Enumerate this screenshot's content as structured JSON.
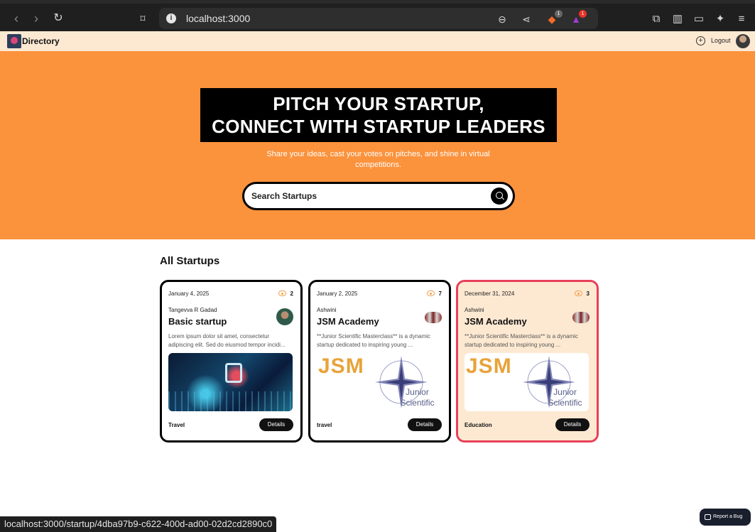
{
  "browser": {
    "url": "localhost:3000",
    "shields_count": "1",
    "rewards_count": "1"
  },
  "navbar": {
    "brand": "Directory",
    "logout_label": "Logout"
  },
  "hero": {
    "title_line1": "PITCH YOUR STARTUP,",
    "title_line2": "CONNECT WITH STARTUP LEADERS",
    "subtitle": "Share your ideas, cast your votes on pitches, and shine in virtual competitions.",
    "search_placeholder": "Search Startups"
  },
  "section": {
    "title": "All Startups"
  },
  "cards": [
    {
      "date": "January 4, 2025",
      "views": "2",
      "author": "Tangevva R Gadad",
      "title": "Basic startup",
      "description": "Lorem ipsum dolor sit amet, consectetur adipiscing elit. Sed do eiusmod tempor incidi...",
      "category": "Travel",
      "button": "Details",
      "image": "tech-lock"
    },
    {
      "date": "January 2, 2025",
      "views": "7",
      "author": "Ashwini",
      "title": "JSM Academy",
      "description": "**Junior Scientific Masterclass** is a dynamic startup dedicated to inspiring young ...",
      "category": "travel",
      "button": "Details",
      "image": "jsm-logo",
      "logo_text": "JSM",
      "logo_sub": "Junior Scientific"
    },
    {
      "date": "December 31, 2024",
      "views": "3",
      "author": "Ashwini",
      "title": "JSM Academy",
      "description": "**Junior Scientific Masterclass** is a dynamic startup dedicated to inspiring young ...",
      "category": "Education",
      "button": "Details",
      "image": "jsm-logo",
      "logo_text": "JSM",
      "logo_sub": "Junior Scientific"
    }
  ],
  "status_bar": {
    "link": "localhost:3000/startup/4dba97b9-c622-400d-ad00-02d2cd2890c0"
  },
  "report_bug": {
    "label": "Report a Bug"
  },
  "colors": {
    "hero_bg": "#fb923c",
    "navbar_bg": "#fde9d2",
    "active_card_border": "#e8405a"
  }
}
